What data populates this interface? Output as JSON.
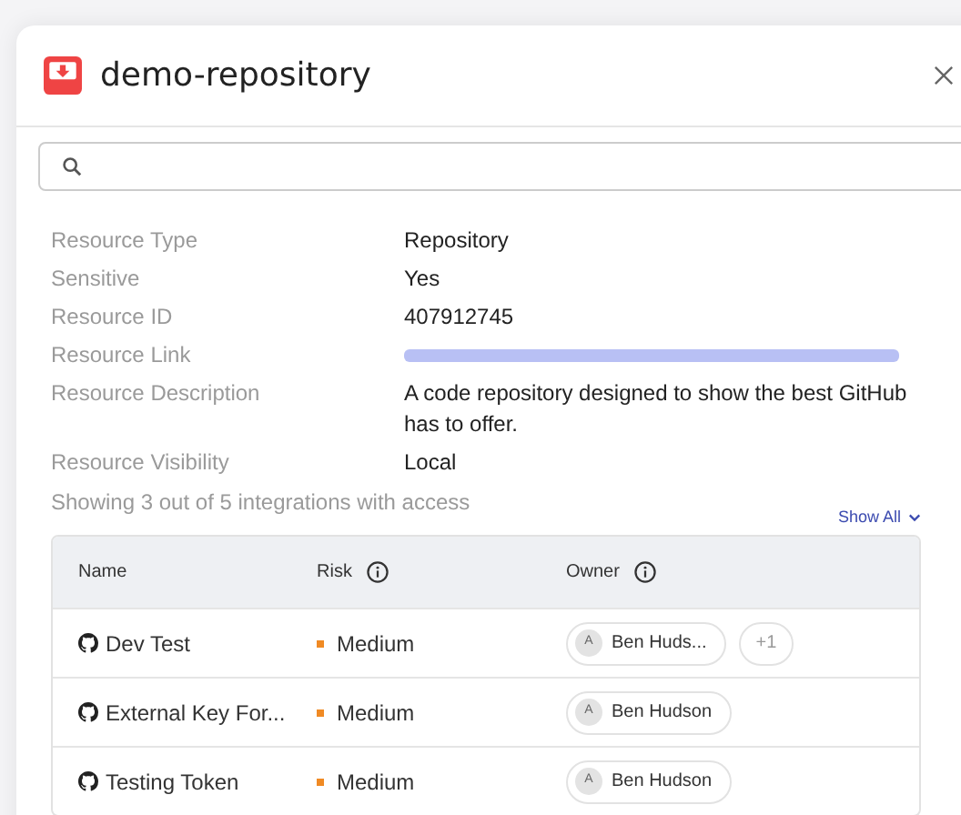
{
  "title": "demo-repository",
  "properties": [
    {
      "label": "Resource Type",
      "value": "Repository",
      "kind": "text"
    },
    {
      "label": "Sensitive",
      "value": "Yes",
      "kind": "text"
    },
    {
      "label": "Resource ID",
      "value": "407912745",
      "kind": "text"
    },
    {
      "label": "Resource Link",
      "kind": "blurred-link"
    },
    {
      "label": "Resource Description",
      "value": "A code repository designed to show the best GitHub has to offer.",
      "kind": "text"
    },
    {
      "label": "Resource Visibility",
      "value": "Local",
      "kind": "text"
    }
  ],
  "integrations_summary": "Showing 3 out of 5 integrations with access",
  "show_all": "Show All",
  "table": {
    "columns": [
      "Name",
      "Risk",
      "Owner"
    ],
    "rows": [
      {
        "name": "Dev Test",
        "risk": "Medium",
        "color": "#f08a24",
        "owner": "Ben Huds...",
        "avatar": "A",
        "extra": "+1"
      },
      {
        "name": "External Key For...",
        "risk": "Medium",
        "color": "#f08a24",
        "owner": "Ben Hudson",
        "avatar": "A"
      },
      {
        "name": "Testing Token",
        "risk": "Medium",
        "color": "#f08a24",
        "owner": "Ben Hudson",
        "avatar": "A"
      }
    ]
  }
}
